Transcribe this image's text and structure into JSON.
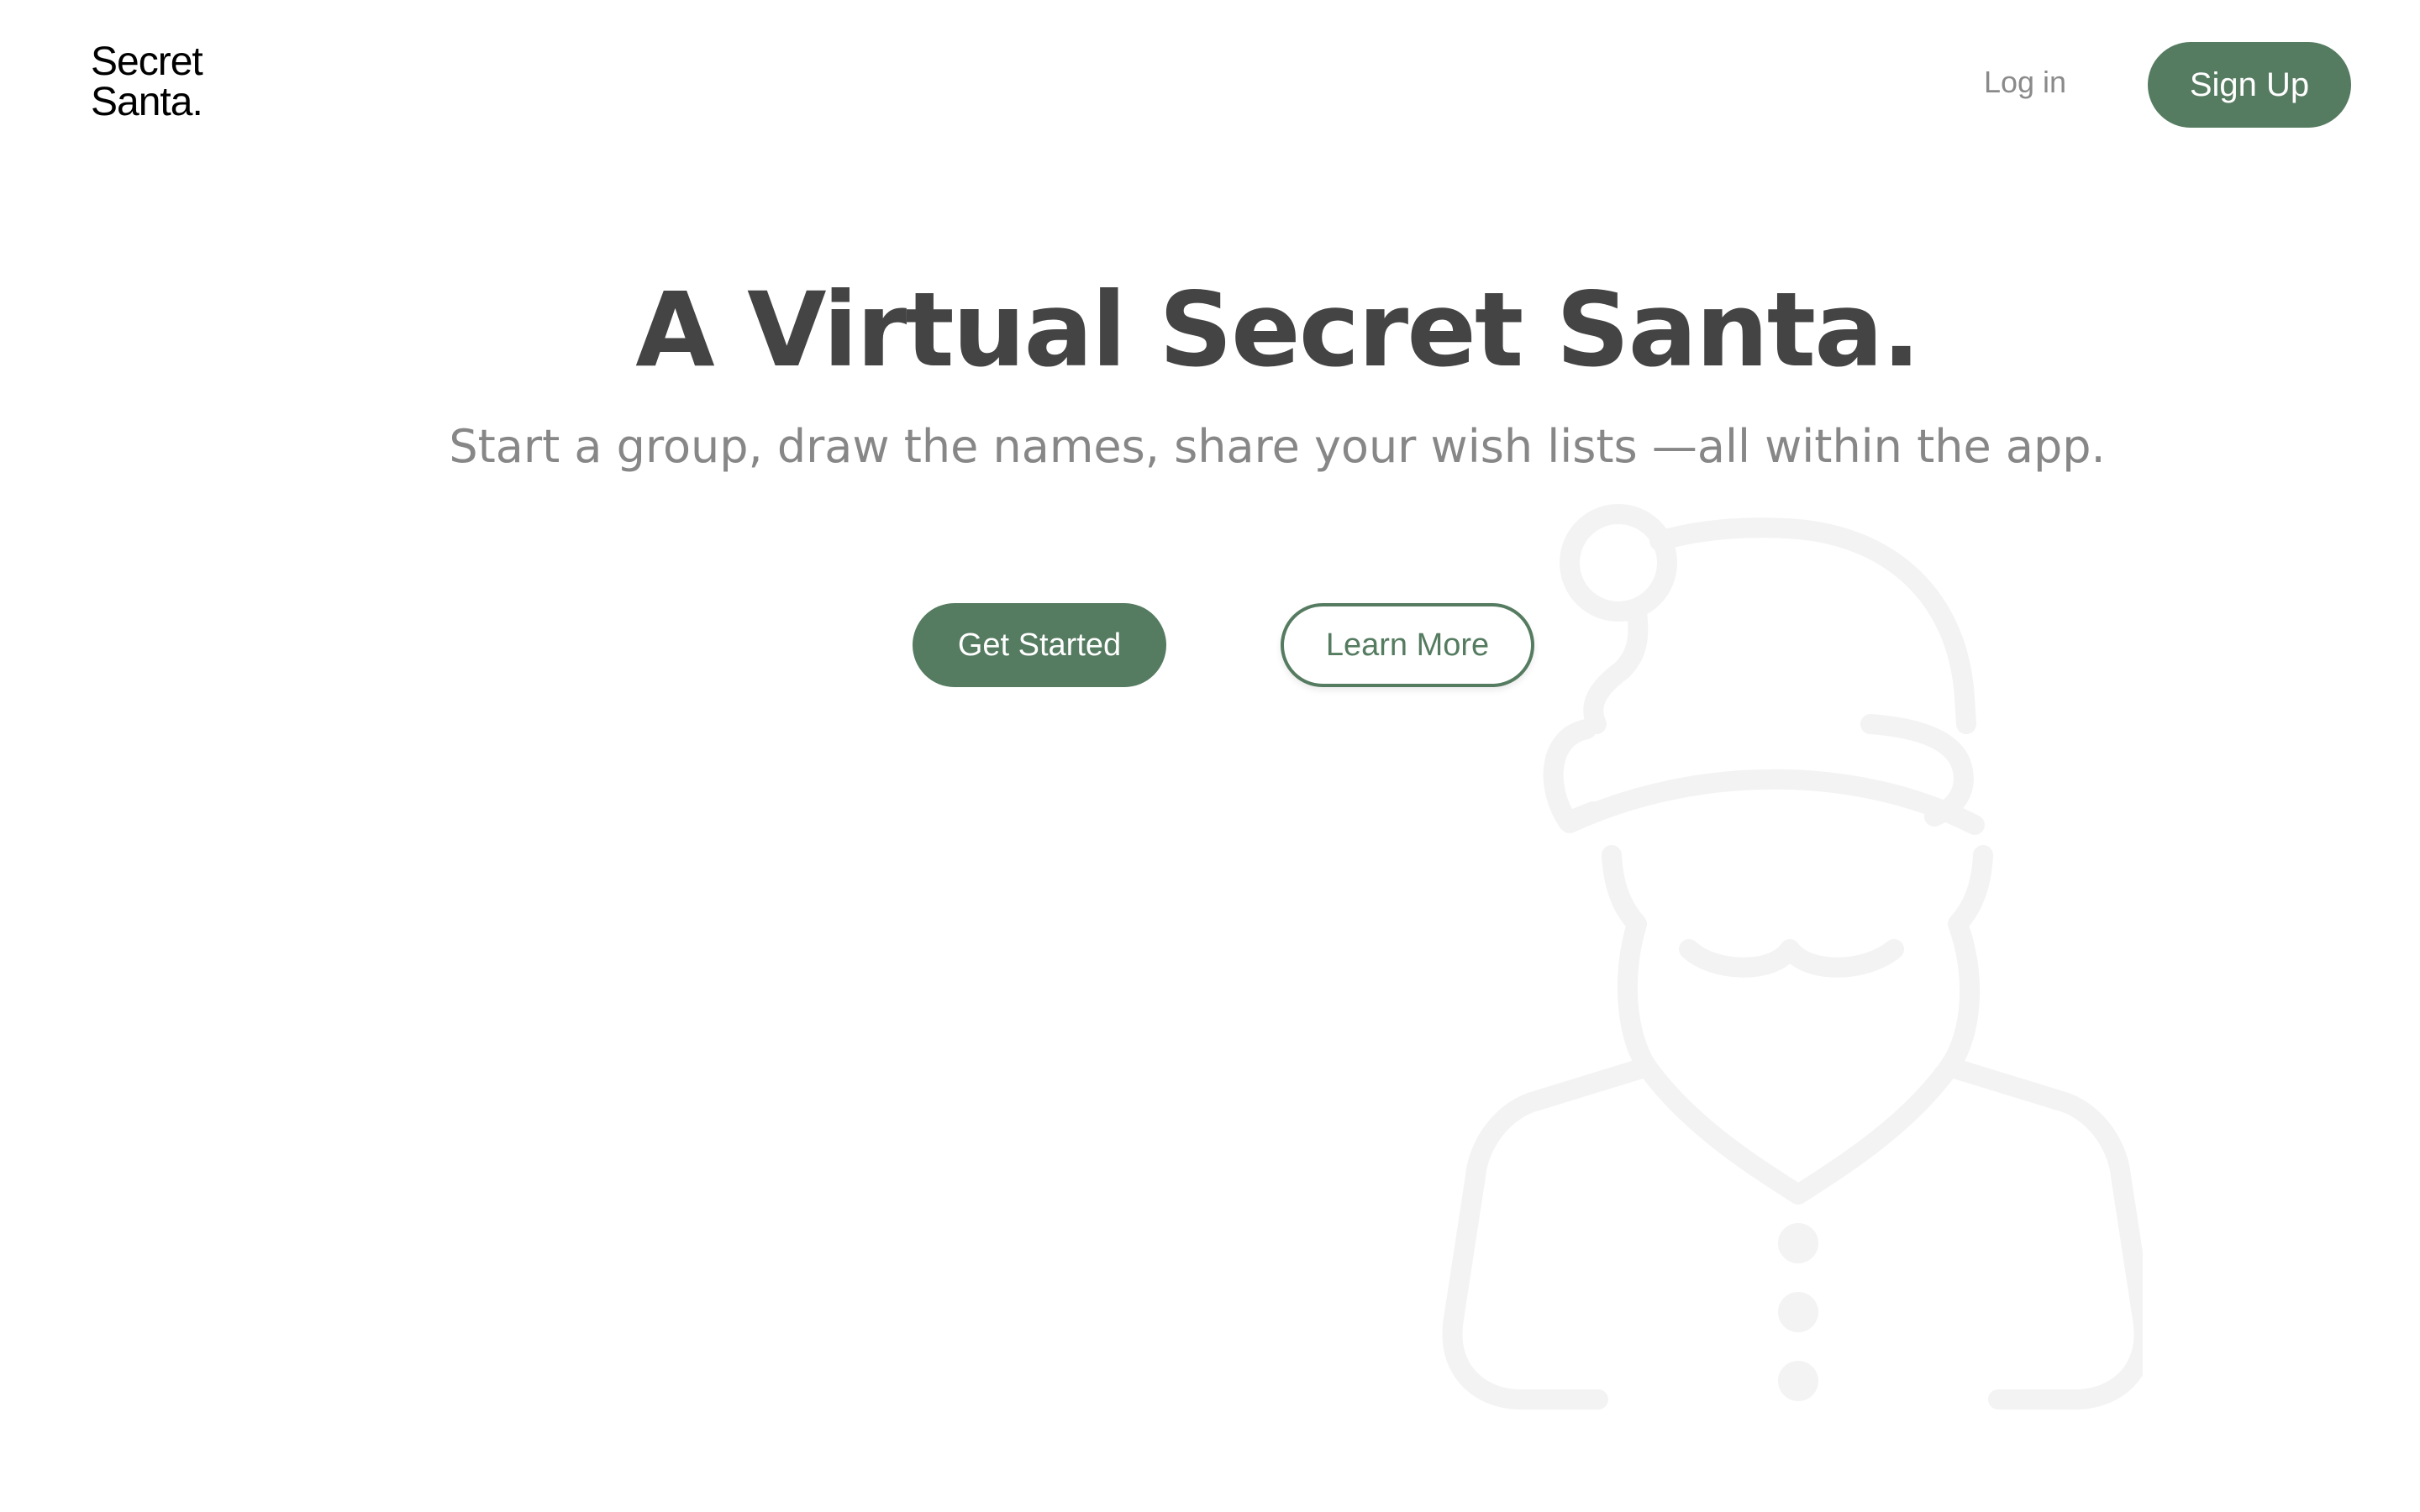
{
  "header": {
    "logo_line1": "Secret",
    "logo_line2": "Santa.",
    "login_label": "Log in",
    "signup_label": "Sign Up"
  },
  "hero": {
    "title": "A Virtual Secret Santa.",
    "subtitle": "Start a group, draw the names, share your wish lists —all within the app.",
    "primary_cta": "Get Started",
    "secondary_cta": "Learn More"
  },
  "colors": {
    "accent": "#557b60",
    "title": "#444444",
    "subtitle": "#878787",
    "illustration": "#f5f5f5"
  },
  "icons": {
    "background_illustration": "santa-outline-icon"
  }
}
